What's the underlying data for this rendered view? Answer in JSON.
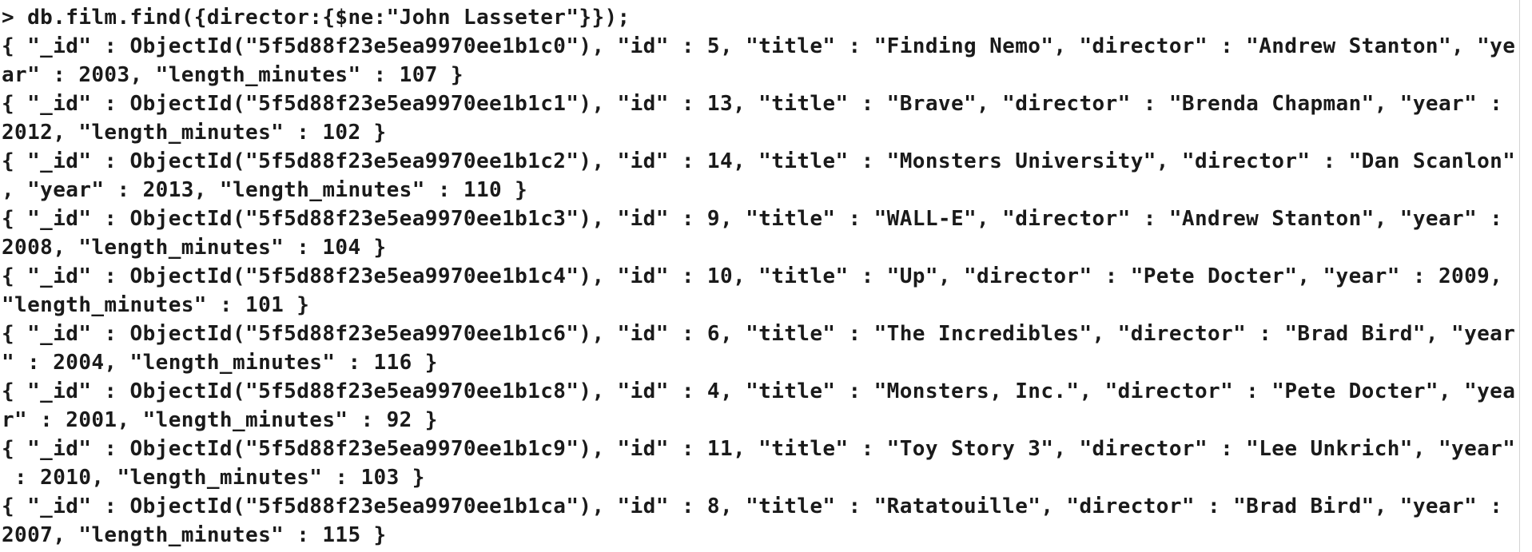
{
  "terminal": {
    "lines": [
      "> db.film.find({director:{$ne:\"John Lasseter\"}});",
      "{ \"_id\" : ObjectId(\"5f5d88f23e5ea9970ee1b1c0\"), \"id\" : 5, \"title\" : \"Finding Nemo\", \"director\" : \"Andrew Stanton\", \"ye",
      "ar\" : 2003, \"length_minutes\" : 107 }",
      "{ \"_id\" : ObjectId(\"5f5d88f23e5ea9970ee1b1c1\"), \"id\" : 13, \"title\" : \"Brave\", \"director\" : \"Brenda Chapman\", \"year\" :",
      "2012, \"length_minutes\" : 102 }",
      "{ \"_id\" : ObjectId(\"5f5d88f23e5ea9970ee1b1c2\"), \"id\" : 14, \"title\" : \"Monsters University\", \"director\" : \"Dan Scanlon\"",
      ", \"year\" : 2013, \"length_minutes\" : 110 }",
      "{ \"_id\" : ObjectId(\"5f5d88f23e5ea9970ee1b1c3\"), \"id\" : 9, \"title\" : \"WALL-E\", \"director\" : \"Andrew Stanton\", \"year\" :",
      "2008, \"length_minutes\" : 104 }",
      "{ \"_id\" : ObjectId(\"5f5d88f23e5ea9970ee1b1c4\"), \"id\" : 10, \"title\" : \"Up\", \"director\" : \"Pete Docter\", \"year\" : 2009,",
      "\"length_minutes\" : 101 }",
      "{ \"_id\" : ObjectId(\"5f5d88f23e5ea9970ee1b1c6\"), \"id\" : 6, \"title\" : \"The Incredibles\", \"director\" : \"Brad Bird\", \"year",
      "\" : 2004, \"length_minutes\" : 116 }",
      "{ \"_id\" : ObjectId(\"5f5d88f23e5ea9970ee1b1c8\"), \"id\" : 4, \"title\" : \"Monsters, Inc.\", \"director\" : \"Pete Docter\", \"yea",
      "r\" : 2001, \"length_minutes\" : 92 }",
      "{ \"_id\" : ObjectId(\"5f5d88f23e5ea9970ee1b1c9\"), \"id\" : 11, \"title\" : \"Toy Story 3\", \"director\" : \"Lee Unkrich\", \"year\"",
      " : 2010, \"length_minutes\" : 103 }",
      "{ \"_id\" : ObjectId(\"5f5d88f23e5ea9970ee1b1ca\"), \"id\" : 8, \"title\" : \"Ratatouille\", \"director\" : \"Brad Bird\", \"year\" :",
      "2007, \"length_minutes\" : 115 }"
    ]
  }
}
